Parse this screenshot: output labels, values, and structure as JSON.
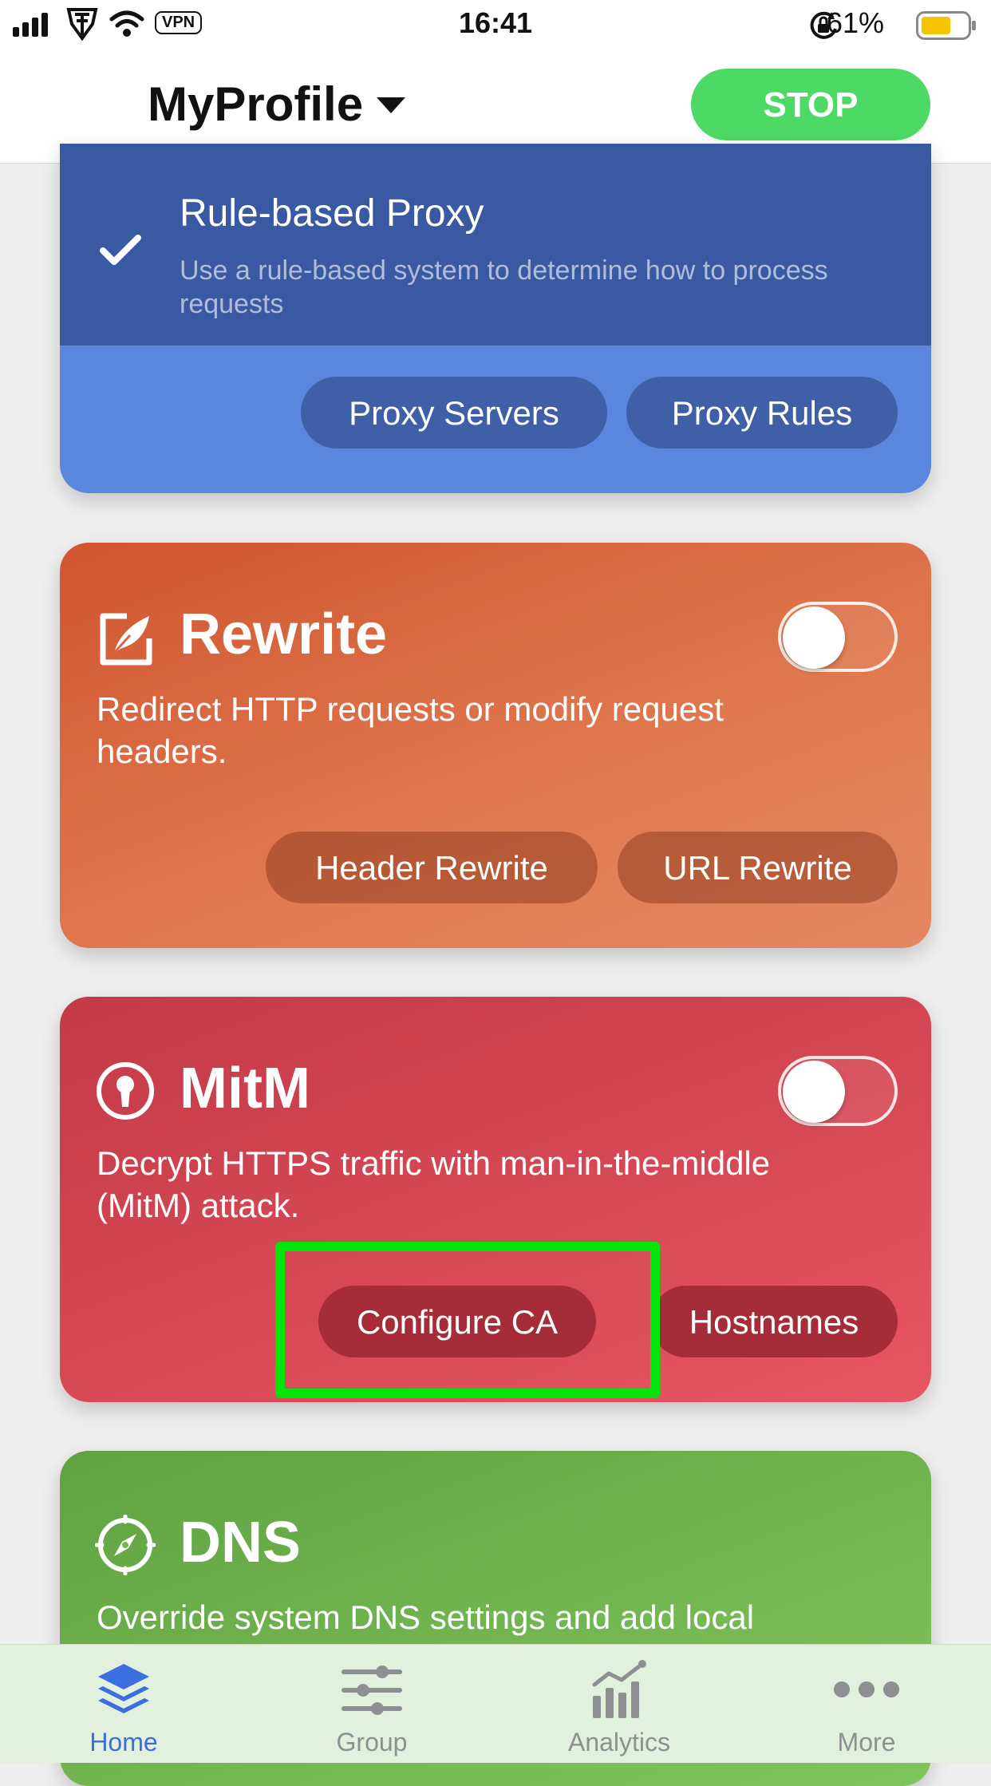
{
  "status_bar": {
    "time": "16:41",
    "vpn": "VPN",
    "battery": "61%"
  },
  "header": {
    "title": "MyProfile",
    "stop_label": "STOP"
  },
  "proxy_card": {
    "title": "Rule-based Proxy",
    "description": "Use a rule-based system to determine how to process requests",
    "buttons": [
      "Proxy Servers",
      "Proxy Rules"
    ]
  },
  "rewrite_card": {
    "title": "Rewrite",
    "description": "Redirect HTTP requests or modify request headers.",
    "toggle_on": false,
    "buttons": [
      "Header Rewrite",
      "URL Rewrite"
    ]
  },
  "mitm_card": {
    "title": "MitM",
    "description": "Decrypt HTTPS traffic with man-in-the-middle (MitM) attack.",
    "toggle_on": false,
    "buttons": [
      "Configure CA",
      "Hostnames"
    ]
  },
  "dns_card": {
    "title": "DNS",
    "description": "Override system DNS settings and add local"
  },
  "tabs": [
    {
      "label": "Home",
      "icon": "layers-icon",
      "active": true
    },
    {
      "label": "Group",
      "icon": "sliders-icon",
      "active": false
    },
    {
      "label": "Analytics",
      "icon": "chart-icon",
      "active": false
    },
    {
      "label": "More",
      "icon": "ellipsis-icon",
      "active": false
    }
  ],
  "colors": {
    "stop": "#4cd964",
    "active_tab": "#3b6fe0",
    "inactive_tab": "#8e8e93",
    "highlight": "#00e60a"
  }
}
